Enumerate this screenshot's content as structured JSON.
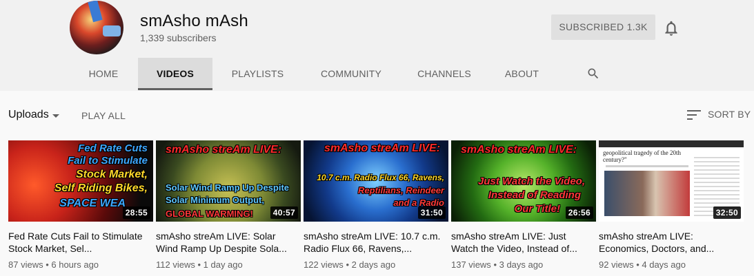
{
  "channel": {
    "name": "smAsho mAsh",
    "subscribers": "1,339 subscribers",
    "subscribe_label": "SUBSCRIBED 1.3K"
  },
  "tabs": [
    {
      "label": "HOME",
      "active": false
    },
    {
      "label": "VIDEOS",
      "active": true
    },
    {
      "label": "PLAYLISTS",
      "active": false
    },
    {
      "label": "COMMUNITY",
      "active": false
    },
    {
      "label": "CHANNELS",
      "active": false
    },
    {
      "label": "ABOUT",
      "active": false
    }
  ],
  "uploads_bar": {
    "uploads_label": "Uploads",
    "play_all_label": "PLAY ALL",
    "sort_label": "SORT BY"
  },
  "videos": [
    {
      "title": "Fed Rate Cuts Fail to Stimulate Stock Market, Sel...",
      "duration": "28:55",
      "views": "87 views",
      "age": "6 hours ago",
      "thumb_lines": [
        "Fed Rate Cuts",
        "Fail to Stimulate",
        "Stock Market,",
        "Self Riding Bikes,",
        "SPACE WEA"
      ]
    },
    {
      "title": "smAsho streAm LIVE: Solar Wind Ramp Up Despite Sola...",
      "duration": "40:57",
      "views": "112 views",
      "age": "1 day ago",
      "thumb_lines": [
        "smAsho streAm LIVE:",
        "Solar Wind Ramp Up Despite",
        "Solar Minimum Output,",
        "GLOBAL WARMING!"
      ]
    },
    {
      "title": "smAsho streAm LIVE: 10.7 c.m. Radio Flux 66, Ravens,...",
      "duration": "31:50",
      "views": "122 views",
      "age": "2 days ago",
      "thumb_lines": [
        "smAsho streAm LIVE:",
        "10.7 c.m. Radio Flux 66, Ravens,",
        "Reptilians, Reindeer",
        "and a Radio"
      ]
    },
    {
      "title": "smAsho streAm LIVE: Just Watch the Video, Instead of...",
      "duration": "26:56",
      "views": "137 views",
      "age": "3 days ago",
      "thumb_lines": [
        "smAsho streAm LIVE:",
        "Just Watch the Video,",
        "Instead of Reading",
        "Our Title!"
      ]
    },
    {
      "title": "smAsho streAm LIVE: Economics, Doctors, and...",
      "duration": "32:50",
      "views": "92 views",
      "age": "4 days ago",
      "thumb_lines": [
        "geopolitical tragedy of the 20th",
        "century?\""
      ]
    }
  ],
  "colors": {
    "header_bg": "#f1f1f1",
    "page_bg": "#f9f9f9",
    "text_secondary": "#606060"
  },
  "icons": {
    "bell": "bell-icon",
    "search": "search-icon",
    "sort": "sort-icon",
    "caret": "caret-down-icon"
  }
}
